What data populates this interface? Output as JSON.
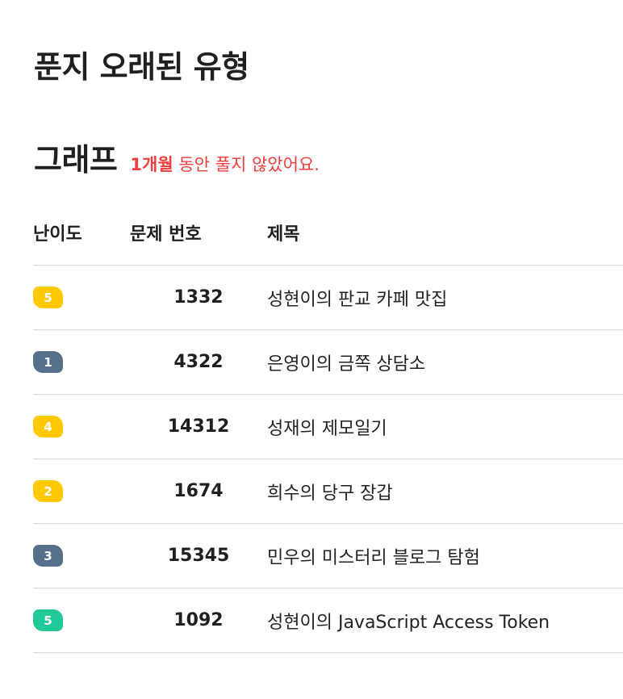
{
  "page": {
    "title": "푼지 오래된 유형"
  },
  "section": {
    "title": "그래프",
    "notice_strong": "1개월",
    "notice_rest": " 동안 풀지 않았어요."
  },
  "table": {
    "headers": {
      "level": "난이도",
      "number": "문제 번호",
      "title": "제목"
    },
    "rows": [
      {
        "tier": "gold",
        "level": "5",
        "number": "1332",
        "title": "성현이의 판교 카페 맛집"
      },
      {
        "tier": "silver",
        "level": "1",
        "number": "4322",
        "title": "은영이의 금쪽 상담소"
      },
      {
        "tier": "gold",
        "level": "4",
        "number": "14312",
        "title": "성재의 제모일기"
      },
      {
        "tier": "gold",
        "level": "2",
        "number": "1674",
        "title": "희수의 당구 장갑"
      },
      {
        "tier": "silver",
        "level": "3",
        "number": "15345",
        "title": "민우의 미스터리 블로그 탐험"
      },
      {
        "tier": "emerald",
        "level": "5",
        "number": "1092",
        "title": "성현이의 JavaScript Access Token"
      }
    ]
  },
  "colors": {
    "gold": "#ffc800",
    "silver": "#56708b",
    "emerald": "#20c997",
    "notice": "#f03e3e"
  }
}
